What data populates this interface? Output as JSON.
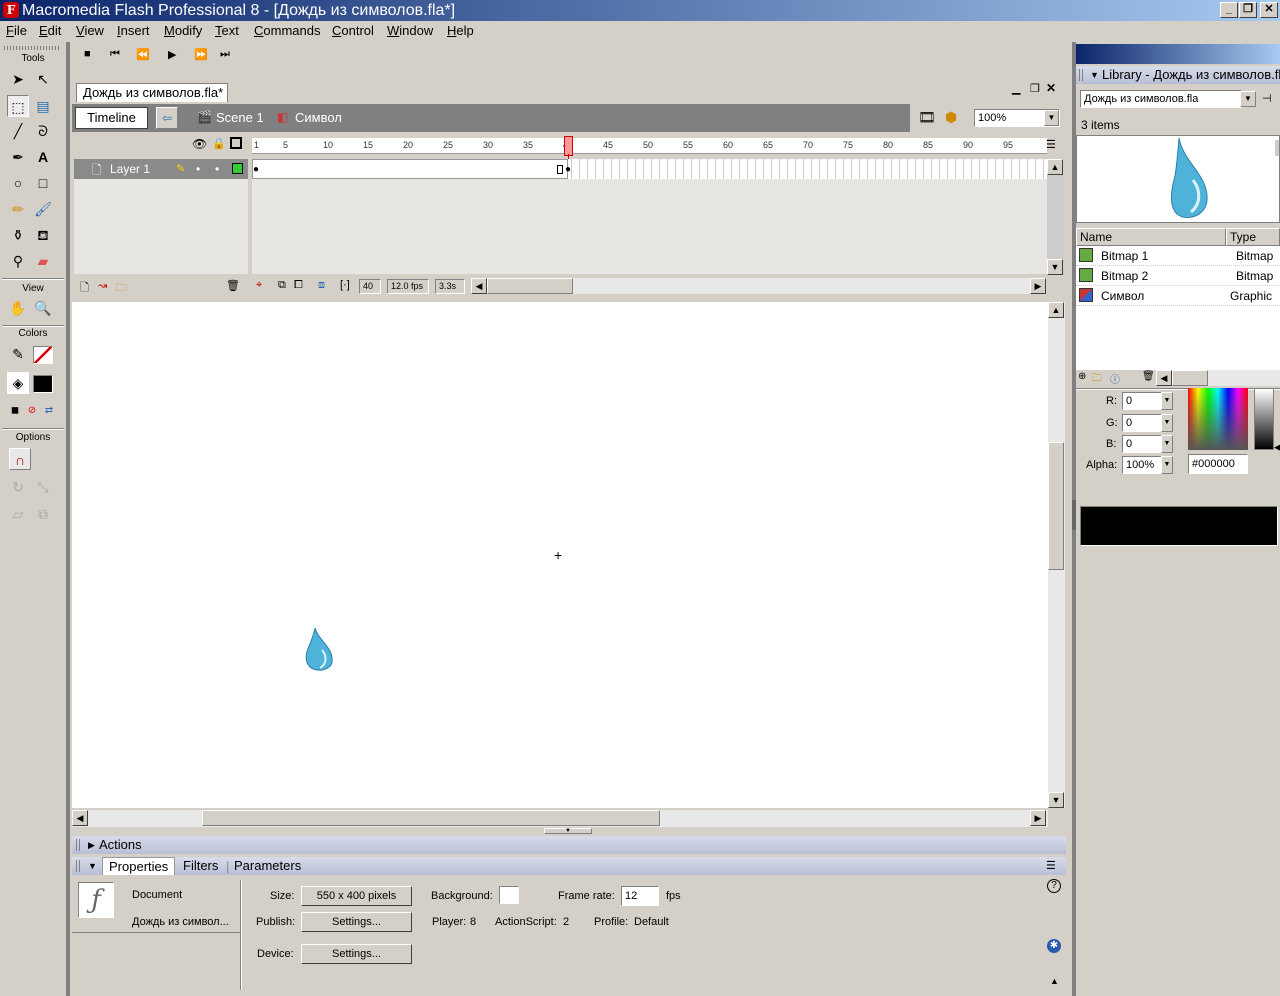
{
  "app": {
    "title": "Macromedia Flash Professional 8 - [Дождь из символов.fla*]",
    "logo_letter": "F"
  },
  "window_controls": {
    "minimize": "_",
    "restore": "❐",
    "close": "✕"
  },
  "menu": [
    "File",
    "Edit",
    "View",
    "Insert",
    "Modify",
    "Text",
    "Commands",
    "Control",
    "Window",
    "Help"
  ],
  "controller": {
    "stop": "■",
    "rewind": "⏮",
    "step_back": "⏪",
    "play": "▶",
    "step_fwd": "⏩",
    "end": "⏭"
  },
  "tools": {
    "title": "Tools",
    "view_label": "View",
    "colors_label": "Colors",
    "options_label": "Options"
  },
  "document": {
    "tab": "Дождь из символов.fla*",
    "timeline_button": "Timeline",
    "scene": "Scene 1",
    "symbol": "Символ",
    "zoom": "100%"
  },
  "timeline": {
    "layer_name": "Layer 1",
    "ruler": [
      "1",
      "5",
      "10",
      "15",
      "20",
      "25",
      "30",
      "35",
      "40",
      "45",
      "50",
      "55",
      "60",
      "65",
      "70",
      "75",
      "80",
      "85",
      "90",
      "95"
    ],
    "current_frame": "40",
    "fps": "12.0 fps",
    "elapsed": "3.3s"
  },
  "panels": {
    "actions": "Actions",
    "properties_tab": "Properties",
    "filters_tab": "Filters",
    "parameters_tab": "Parameters",
    "doc_label": "Document",
    "doc_name": "Дождь из символ...",
    "size_label": "Size:",
    "size_value": "550 x 400 pixels",
    "background_label": "Background:",
    "frame_rate_label": "Frame rate:",
    "frame_rate_value": "12",
    "fps_unit": "fps",
    "publish_label": "Publish:",
    "settings_button": "Settings...",
    "player_label": "Player:",
    "player_value": "8",
    "actionscript_label": "ActionScript:",
    "actionscript_value": "2",
    "profile_label": "Profile:",
    "profile_value": "Default",
    "device_label": "Device:",
    "device_settings": "Settings..."
  },
  "library": {
    "title": "Library - Дождь из символов.fla",
    "dropdown": "Дождь из символов.fla",
    "count": "3 items",
    "col_name": "Name",
    "col_type": "Type",
    "items": [
      {
        "name": "Bitmap 1",
        "type": "Bitmap"
      },
      {
        "name": "Bitmap 2",
        "type": "Bitmap"
      },
      {
        "name": "Символ",
        "type": "Graphic"
      }
    ]
  },
  "color_mixer": {
    "r_label": "R:",
    "r": "0",
    "g_label": "G:",
    "g": "0",
    "b_label": "B:",
    "b": "0",
    "alpha_label": "Alpha:",
    "alpha": "100%",
    "hex": "#000000",
    "swatch_color": "#000000"
  },
  "colors": {
    "drop": "#4fb3d9",
    "accent": "#0a246a"
  }
}
